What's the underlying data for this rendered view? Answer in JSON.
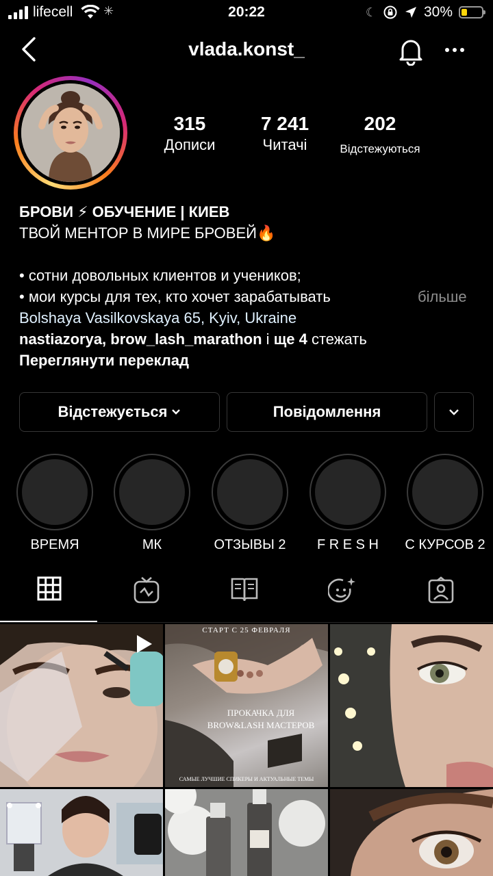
{
  "status_bar": {
    "carrier": "lifecell",
    "time": "20:22",
    "battery": "30%",
    "battery_level": 0.3,
    "colors": {
      "battery_fill": "#ffd60a"
    }
  },
  "header": {
    "username": "vlada.konst_",
    "icons": [
      "back-icon",
      "bell-icon",
      "more-icon"
    ]
  },
  "stats": [
    {
      "value": "315",
      "label": "Дописи"
    },
    {
      "value": "7 241",
      "label": "Читачі"
    },
    {
      "value": "202",
      "label": "Відстежуються"
    }
  ],
  "bio": {
    "title": "БРОВИ ⚡ ОБУЧЕНИЕ | КИЕВ",
    "subtitle": "ТВОЙ МЕНТОР В МИРЕ БРОВЕЙ🔥",
    "bullet1": "• сотни довольных клиентов и учеников;",
    "bullet2": "• мои курсы для тех, кто хочет зарабатывать",
    "more": "більше",
    "location": "Bolshaya Vasilkovskaya 65, Kyiv, Ukraine",
    "followed_by": {
      "names": "nastiazorya, brow_lash_marathon",
      "and": " і ",
      "more_count": "ще 4",
      "suffix": " стежать"
    },
    "translate": "Переглянути переклад"
  },
  "buttons": {
    "following": "Відстежується",
    "message": "Повідомлення"
  },
  "highlights": [
    {
      "label": "ВРЕМЯ"
    },
    {
      "label": "МК"
    },
    {
      "label": "ОТЗЫВЫ 2"
    },
    {
      "label": "F R E S H"
    },
    {
      "label": "С КУРСОВ 2"
    }
  ],
  "tabs": [
    {
      "icon": "grid-icon",
      "active": true
    },
    {
      "icon": "igtv-icon",
      "active": false
    },
    {
      "icon": "guide-icon",
      "active": false
    },
    {
      "icon": "effects-icon",
      "active": false
    },
    {
      "icon": "tagged-icon",
      "active": false
    }
  ],
  "posts": {
    "post2": {
      "top": "СТАРТ С 25 ФЕВРАЛЯ",
      "title1": "ПРОКАЧКА ДЛЯ",
      "title2": "BROW&LASH МАСТЕРОВ",
      "bottom": "САМЫЕ ЛУЧШИЕ СПИКЕРЫ И АКТУАЛЬНЫЕ ТЕМЫ"
    }
  }
}
